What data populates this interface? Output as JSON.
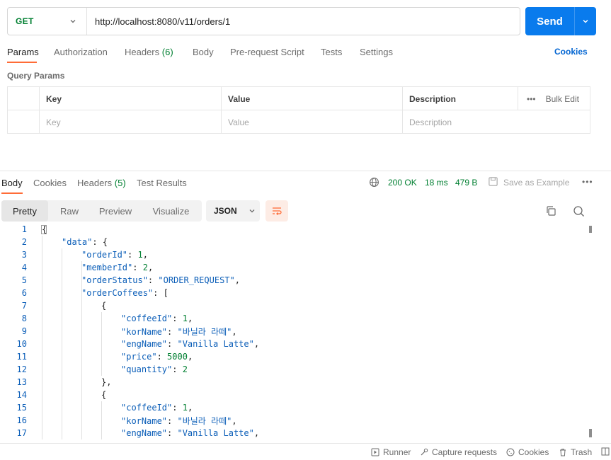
{
  "request": {
    "method": "GET",
    "url": "http://localhost:8080/v11/orders/1",
    "send_label": "Send"
  },
  "request_tabs": [
    {
      "label": "Params",
      "count": ""
    },
    {
      "label": "Authorization",
      "count": ""
    },
    {
      "label": "Headers",
      "count": "(6)"
    },
    {
      "label": "Body",
      "count": ""
    },
    {
      "label": "Pre-request Script",
      "count": ""
    },
    {
      "label": "Tests",
      "count": ""
    },
    {
      "label": "Settings",
      "count": ""
    }
  ],
  "cookies_link": "Cookies",
  "query_params": {
    "title": "Query Params",
    "columns": [
      "Key",
      "Value",
      "Description"
    ],
    "placeholders": [
      "Key",
      "Value",
      "Description"
    ],
    "bulk_edit": "Bulk Edit"
  },
  "response_tabs": [
    {
      "label": "Body",
      "count": ""
    },
    {
      "label": "Cookies",
      "count": ""
    },
    {
      "label": "Headers",
      "count": "(5)"
    },
    {
      "label": "Test Results",
      "count": ""
    }
  ],
  "response_meta": {
    "status": "200 OK",
    "time": "18 ms",
    "size": "479 B",
    "save_example": "Save as Example"
  },
  "view_modes": [
    "Pretty",
    "Raw",
    "Preview",
    "Visualize"
  ],
  "format": "JSON",
  "code_lines": [
    {
      "n": "1",
      "indent": 0,
      "tokens": [
        [
          "p",
          "{"
        ]
      ]
    },
    {
      "n": "2",
      "indent": 1,
      "tokens": [
        [
          "k",
          "\"data\""
        ],
        [
          "p",
          ": {"
        ]
      ]
    },
    {
      "n": "3",
      "indent": 2,
      "tokens": [
        [
          "k",
          "\"orderId\""
        ],
        [
          "p",
          ": "
        ],
        [
          "n",
          "1"
        ],
        [
          "p",
          ","
        ]
      ]
    },
    {
      "n": "4",
      "indent": 2,
      "tokens": [
        [
          "k",
          "\"memberId\""
        ],
        [
          "p",
          ": "
        ],
        [
          "n",
          "2"
        ],
        [
          "p",
          ","
        ]
      ]
    },
    {
      "n": "5",
      "indent": 2,
      "tokens": [
        [
          "k",
          "\"orderStatus\""
        ],
        [
          "p",
          ": "
        ],
        [
          "s",
          "\"ORDER_REQUEST\""
        ],
        [
          "p",
          ","
        ]
      ]
    },
    {
      "n": "6",
      "indent": 2,
      "tokens": [
        [
          "k",
          "\"orderCoffees\""
        ],
        [
          "p",
          ": ["
        ]
      ]
    },
    {
      "n": "7",
      "indent": 3,
      "tokens": [
        [
          "p",
          "{"
        ]
      ]
    },
    {
      "n": "8",
      "indent": 4,
      "tokens": [
        [
          "k",
          "\"coffeeId\""
        ],
        [
          "p",
          ": "
        ],
        [
          "n",
          "1"
        ],
        [
          "p",
          ","
        ]
      ]
    },
    {
      "n": "9",
      "indent": 4,
      "tokens": [
        [
          "k",
          "\"korName\""
        ],
        [
          "p",
          ": "
        ],
        [
          "s",
          "\"바닐라 라떼\""
        ],
        [
          "p",
          ","
        ]
      ]
    },
    {
      "n": "10",
      "indent": 4,
      "tokens": [
        [
          "k",
          "\"engName\""
        ],
        [
          "p",
          ": "
        ],
        [
          "s",
          "\"Vanilla Latte\""
        ],
        [
          "p",
          ","
        ]
      ]
    },
    {
      "n": "11",
      "indent": 4,
      "tokens": [
        [
          "k",
          "\"price\""
        ],
        [
          "p",
          ": "
        ],
        [
          "n",
          "5000"
        ],
        [
          "p",
          ","
        ]
      ]
    },
    {
      "n": "12",
      "indent": 4,
      "tokens": [
        [
          "k",
          "\"quantity\""
        ],
        [
          "p",
          ": "
        ],
        [
          "n",
          "2"
        ]
      ]
    },
    {
      "n": "13",
      "indent": 3,
      "tokens": [
        [
          "p",
          "},"
        ]
      ]
    },
    {
      "n": "14",
      "indent": 3,
      "tokens": [
        [
          "p",
          "{"
        ]
      ]
    },
    {
      "n": "15",
      "indent": 4,
      "tokens": [
        [
          "k",
          "\"coffeeId\""
        ],
        [
          "p",
          ": "
        ],
        [
          "n",
          "1"
        ],
        [
          "p",
          ","
        ]
      ]
    },
    {
      "n": "16",
      "indent": 4,
      "tokens": [
        [
          "k",
          "\"korName\""
        ],
        [
          "p",
          ": "
        ],
        [
          "s",
          "\"바닐라 라떼\""
        ],
        [
          "p",
          ","
        ]
      ]
    },
    {
      "n": "17",
      "indent": 4,
      "tokens": [
        [
          "k",
          "\"engName\""
        ],
        [
          "p",
          ": "
        ],
        [
          "s",
          "\"Vanilla Latte\""
        ],
        [
          "p",
          ","
        ]
      ]
    }
  ],
  "footer": {
    "runner": "Runner",
    "capture": "Capture requests",
    "cookies": "Cookies",
    "trash": "Trash"
  },
  "colors": {
    "accent": "#ff6c37",
    "send": "#097bed",
    "success": "#007f31",
    "link": "#0265d2"
  }
}
